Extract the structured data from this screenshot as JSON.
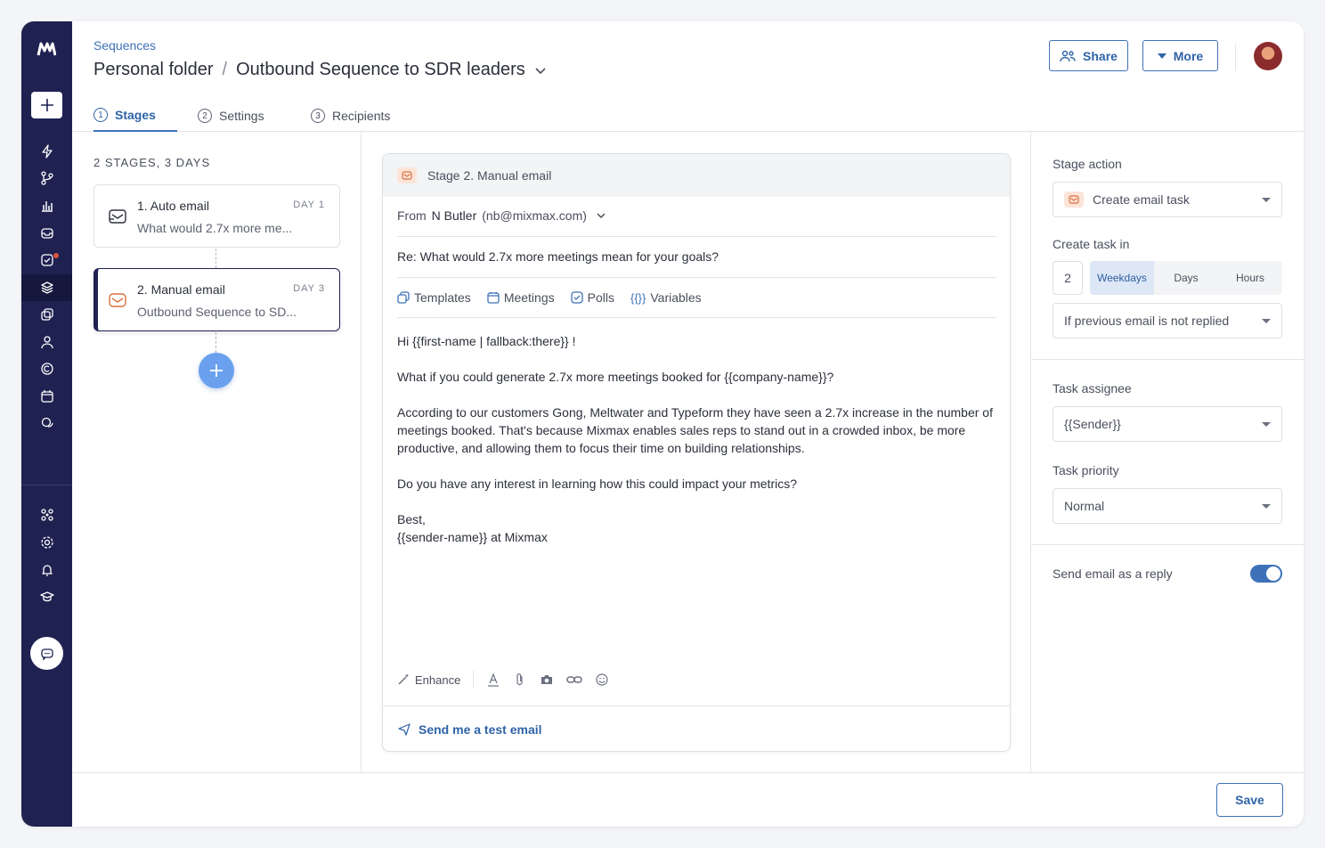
{
  "header": {
    "breadcrumb": "Sequences",
    "folder": "Personal folder",
    "separator": "/",
    "sequence_name": "Outbound Sequence to SDR leaders",
    "share_label": "Share",
    "more_label": "More"
  },
  "tabs": [
    {
      "num": "1",
      "label": "Stages"
    },
    {
      "num": "2",
      "label": "Settings"
    },
    {
      "num": "3",
      "label": "Recipients"
    }
  ],
  "stages": {
    "summary": "2 STAGES, 3 DAYS",
    "items": [
      {
        "name": "1. Auto email",
        "day": "DAY 1",
        "preview": "What would 2.7x more me..."
      },
      {
        "name": "2. Manual email",
        "day": "DAY 3",
        "preview": "Outbound Sequence to SD..."
      }
    ]
  },
  "editor": {
    "stage_title": "Stage 2. Manual email",
    "from_label": "From",
    "sender_name": "N Butler",
    "sender_email": "(nb@mixmax.com)",
    "subject": "Re: What would 2.7x more meetings mean for your goals?",
    "tools": {
      "templates": "Templates",
      "meetings": "Meetings",
      "polls": "Polls",
      "variables": "Variables"
    },
    "body": {
      "p1": "Hi {{first-name | fallback:there}} !",
      "p2": "What if you could generate 2.7x more meetings booked for {{company-name}}?",
      "p3": "According to our customers Gong, Meltwater and Typeform they have seen a 2.7x increase in the number of meetings booked. That's because Mixmax enables sales reps to stand out in a crowded inbox, be more productive, and allowing them to focus their time on building relationships.",
      "p4": "Do you have any interest in learning how this could impact your metrics?",
      "sign1": "Best,",
      "sign2": "{{sender-name}} at Mixmax"
    },
    "enhance_label": "Enhance",
    "test_email_label": "Send me a test email"
  },
  "settings": {
    "stage_action_label": "Stage action",
    "stage_action_value": "Create email task",
    "create_task_in_label": "Create task in",
    "task_delay": "2",
    "units": [
      "Weekdays",
      "Days",
      "Hours"
    ],
    "selected_unit": "Weekdays",
    "condition_value": "If previous email is not replied",
    "task_assignee_label": "Task assignee",
    "task_assignee_value": "{{Sender}}",
    "task_priority_label": "Task priority",
    "task_priority_value": "Normal",
    "send_as_reply_label": "Send email as a reply",
    "send_as_reply_on": true
  },
  "footer": {
    "save_label": "Save"
  },
  "colors": {
    "sidebar": "#1f2251",
    "accent": "#3d72b8",
    "add_button": "#6aa0ee",
    "notification": "#e2543c"
  }
}
